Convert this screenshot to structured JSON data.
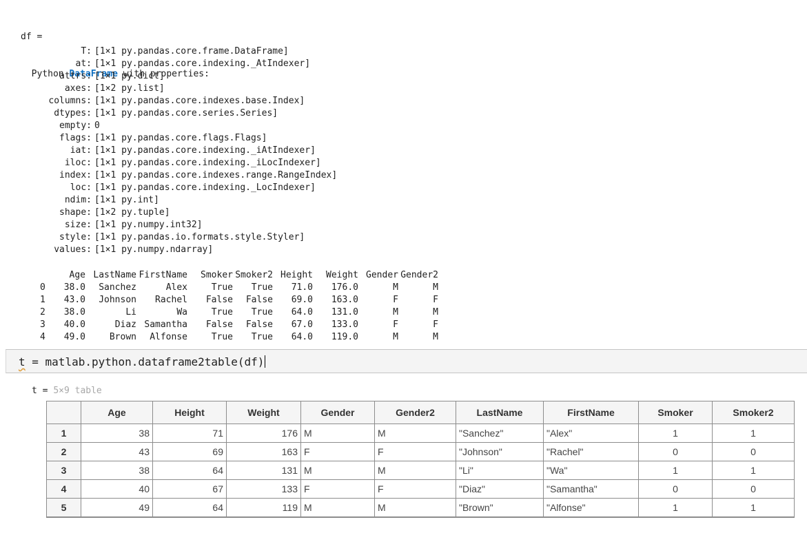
{
  "output": {
    "var_line": "df =",
    "desc_prefix": "  Python ",
    "desc_class": "DataFrame",
    "desc_suffix": " with properties:",
    "properties": [
      {
        "name": "T:",
        "value": "[1×1 py.pandas.core.frame.DataFrame]"
      },
      {
        "name": "at:",
        "value": "[1×1 py.pandas.core.indexing._AtIndexer]"
      },
      {
        "name": "attrs:",
        "value": "[1×1 py.dict]"
      },
      {
        "name": "axes:",
        "value": "[1×2 py.list]"
      },
      {
        "name": "columns:",
        "value": "[1×1 py.pandas.core.indexes.base.Index]"
      },
      {
        "name": "dtypes:",
        "value": "[1×1 py.pandas.core.series.Series]"
      },
      {
        "name": "empty:",
        "value": "0"
      },
      {
        "name": "flags:",
        "value": "[1×1 py.pandas.core.flags.Flags]"
      },
      {
        "name": "iat:",
        "value": "[1×1 py.pandas.core.indexing._iAtIndexer]"
      },
      {
        "name": "iloc:",
        "value": "[1×1 py.pandas.core.indexing._iLocIndexer]"
      },
      {
        "name": "index:",
        "value": "[1×1 py.pandas.core.indexes.range.RangeIndex]"
      },
      {
        "name": "loc:",
        "value": "[1×1 py.pandas.core.indexing._LocIndexer]"
      },
      {
        "name": "ndim:",
        "value": "[1×1 py.int]"
      },
      {
        "name": "shape:",
        "value": "[1×2 py.tuple]"
      },
      {
        "name": "size:",
        "value": "[1×1 py.numpy.int32]"
      },
      {
        "name": "style:",
        "value": "[1×1 py.pandas.io.formats.style.Styler]"
      },
      {
        "name": "values:",
        "value": "[1×1 py.numpy.ndarray]"
      }
    ],
    "pandas_table": {
      "headers": [
        "",
        "Age",
        "LastName",
        "FirstName",
        "Smoker",
        "Smoker2",
        "Height",
        "Weight",
        "Gender",
        "Gender2"
      ],
      "rows": [
        [
          "0",
          "38.0",
          "Sanchez",
          "Alex",
          "True",
          "True",
          "71.0",
          "176.0",
          "M",
          "M"
        ],
        [
          "1",
          "43.0",
          "Johnson",
          "Rachel",
          "False",
          "False",
          "69.0",
          "163.0",
          "F",
          "F"
        ],
        [
          "2",
          "38.0",
          "Li",
          "Wa",
          "True",
          "True",
          "64.0",
          "131.0",
          "M",
          "M"
        ],
        [
          "3",
          "40.0",
          "Diaz",
          "Samantha",
          "False",
          "False",
          "67.0",
          "133.0",
          "F",
          "F"
        ],
        [
          "4",
          "49.0",
          "Brown",
          "Alfonse",
          "True",
          "True",
          "64.0",
          "119.0",
          "M",
          "M"
        ]
      ]
    }
  },
  "command": {
    "var": "t",
    "rest": " = matlab.python.dataframe2table(df)"
  },
  "result": {
    "var_label": "t = ",
    "size_label": "5×9 table",
    "headers": [
      "",
      "Age",
      "Height",
      "Weight",
      "Gender",
      "Gender2",
      "LastName",
      "FirstName",
      "Smoker",
      "Smoker2"
    ],
    "rows": [
      [
        "1",
        "38",
        "71",
        "176",
        "M",
        "M",
        "\"Sanchez\"",
        "\"Alex\"",
        "1",
        "1"
      ],
      [
        "2",
        "43",
        "69",
        "163",
        "F",
        "F",
        "\"Johnson\"",
        "\"Rachel\"",
        "0",
        "0"
      ],
      [
        "3",
        "38",
        "64",
        "131",
        "M",
        "M",
        "\"Li\"",
        "\"Wa\"",
        "1",
        "1"
      ],
      [
        "4",
        "40",
        "67",
        "133",
        "F",
        "F",
        "\"Diaz\"",
        "\"Samantha\"",
        "0",
        "0"
      ],
      [
        "5",
        "49",
        "64",
        "119",
        "M",
        "M",
        "\"Brown\"",
        "\"Alfonse\"",
        "1",
        "1"
      ]
    ]
  }
}
